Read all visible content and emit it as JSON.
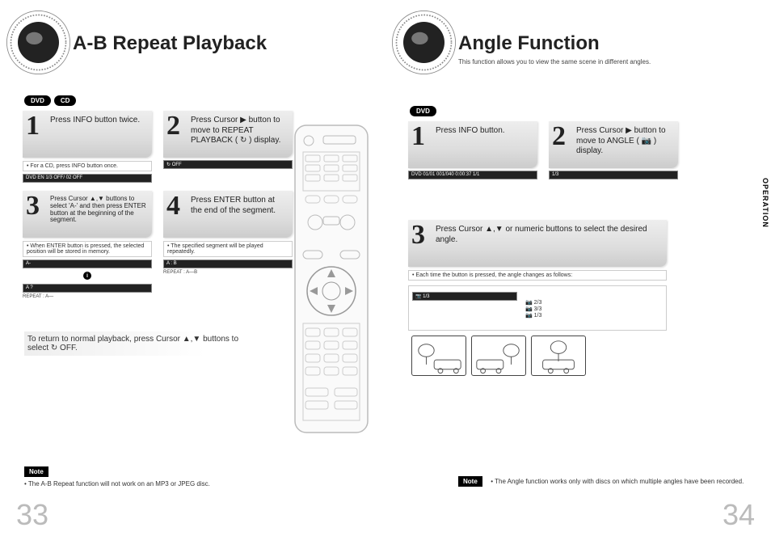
{
  "left": {
    "title": "A-B Repeat Playback",
    "badges": [
      "DVD",
      "CD"
    ],
    "steps": {
      "s1": {
        "num": "1",
        "text": "Press INFO button twice.",
        "note": "• For a CD, press INFO button once.",
        "osd": "DVD  EN 1/3  OFF/ 02  OFF"
      },
      "s2": {
        "num": "2",
        "text": "Press Cursor ▶ button to move to REPEAT PLAYBACK ( ↻ ) display.",
        "osd": "↻ OFF"
      },
      "s3": {
        "num": "3",
        "text": "Press Cursor ▲,▼ buttons to select 'A-' and then press ENTER button at the beginning of the segment.",
        "note": "• When ENTER button is pressed, the selected position will be stored in memory.",
        "osd1": "A-",
        "osd2": "A ?",
        "caption": "REPEAT : A—"
      },
      "s4": {
        "num": "4",
        "text": "Press ENTER button at the end of the segment.",
        "note": "• The specified segment will be played repeatedly.",
        "osd": "A : B",
        "caption": "REPEAT : A—B"
      }
    },
    "footer": "To return to normal playback, press Cursor ▲,▼ buttons to select ↻ OFF.",
    "note_label": "Note",
    "note_text": "• The A-B Repeat function will not work on an MP3 or JPEG disc.",
    "pagenum": "33"
  },
  "right": {
    "title": "Angle Function",
    "subtitle": "This function allows you to view the same scene in different angles.",
    "badges": [
      "DVD"
    ],
    "steps": {
      "s1": {
        "num": "1",
        "text": "Press INFO button.",
        "osd": "DVD  01/01  001/040  0:00:37  1/1"
      },
      "s2": {
        "num": "2",
        "text": "Press Cursor ▶ button to move to ANGLE ( 📷 ) display.",
        "osd": "1/3"
      },
      "s3": {
        "num": "3",
        "text": "Press Cursor ▲,▼ or numeric buttons to select the desired angle.",
        "note": "• Each time the button is pressed, the angle changes as follows:",
        "ticks": "1/3 → 2/3 → 3/3 → 1/3"
      }
    },
    "note_label": "Note",
    "note_text": "• The Angle function works only with discs on which multiple angles have been recorded.",
    "side_tab": "OPERATION",
    "pagenum": "34"
  }
}
